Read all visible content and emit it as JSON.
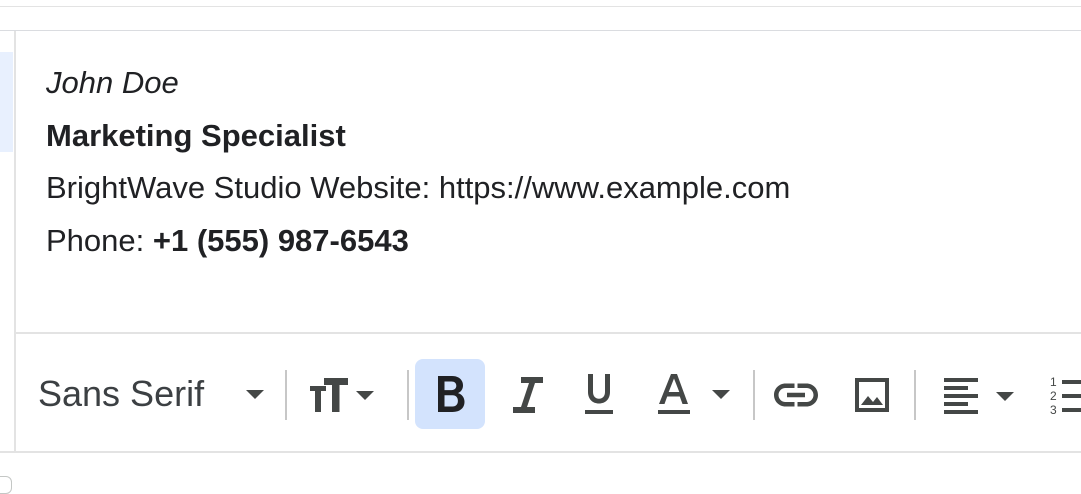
{
  "signature": {
    "name": "John Doe",
    "title": "Marketing Specialist",
    "website_line": "BrightWave Studio Website: https://www.example.com",
    "phone_label": "Phone: ",
    "phone_number": "+1 (555) 987-6543"
  },
  "toolbar": {
    "font_family": "Sans Serif",
    "bold_active": true,
    "icons": [
      "font-size-icon",
      "bold-icon",
      "italic-icon",
      "underline-icon",
      "text-color-icon",
      "link-icon",
      "image-icon",
      "align-left-icon",
      "numbered-list-icon"
    ]
  },
  "colors": {
    "active_button_bg": "#d3e3fd",
    "icon": "#444746",
    "text": "#202124"
  }
}
